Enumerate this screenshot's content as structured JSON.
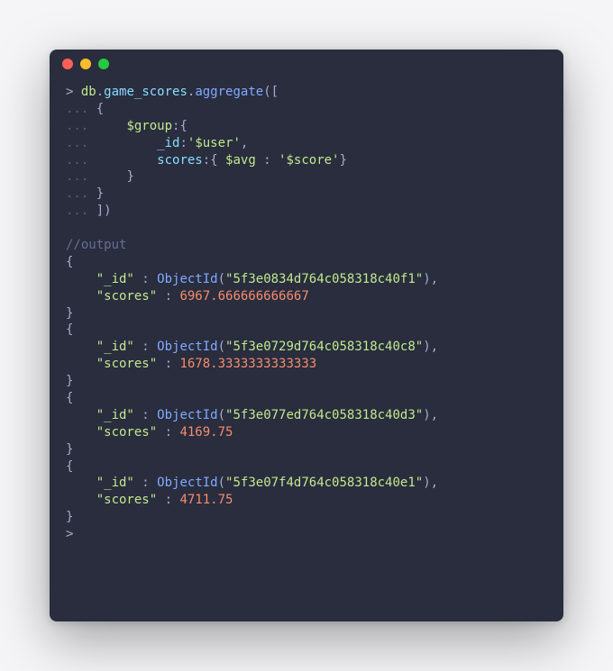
{
  "window": {
    "buttons": {
      "red": "close",
      "yellow": "minimize",
      "green": "maximize"
    }
  },
  "code": {
    "prompt": ">",
    "cont": "...",
    "db": "db",
    "dot": ".",
    "collection": "game_scores",
    "method": "aggregate",
    "openParenBracket": "([",
    "openBrace": "{",
    "group": "$group",
    "colonBrace": ":{",
    "idField": "_id",
    "colon": ":",
    "userRef": "'$user'",
    "comma": ",",
    "scoresField": "scores",
    "colonBraceSpace": ":{ ",
    "avg": "$avg",
    "spaceColonSpace": " : ",
    "scoreRef": "'$score'",
    "closeBrace": "}",
    "closeBracketParen": "])",
    "comment": "//output",
    "objectId": "ObjectId",
    "openParen": "(",
    "closeParen": ")",
    "quote": "\"",
    "idKey": "\"_id\"",
    "scoresKey": "\"scores\"",
    "results": [
      {
        "oid": "5f3e0834d764c058318c40f1",
        "score": "6967.666666666667"
      },
      {
        "oid": "5f3e0729d764c058318c40c8",
        "score": "1678.3333333333333"
      },
      {
        "oid": "5f3e077ed764c058318c40d3",
        "score": "4169.75"
      },
      {
        "oid": "5f3e07f4d764c058318c40e1",
        "score": "4711.75"
      }
    ]
  }
}
